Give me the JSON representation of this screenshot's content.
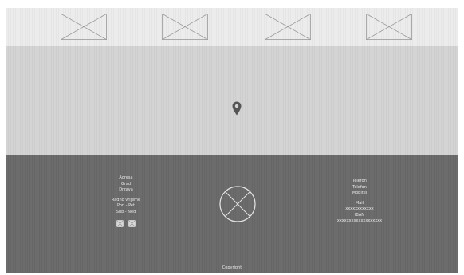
{
  "header": {
    "placeholders": [
      {
        "name": "image-placeholder-1"
      },
      {
        "name": "image-placeholder-2"
      },
      {
        "name": "image-placeholder-3"
      },
      {
        "name": "image-placeholder-4"
      }
    ]
  },
  "map": {
    "icon": "map-pin-icon",
    "pin_color": "#555555"
  },
  "footer": {
    "left_column": {
      "address_lines": [
        "Adresa",
        "Grad",
        "Drzava"
      ],
      "hours_title": "Radno vrijeme",
      "hours": [
        "Pon - Pet",
        "Sub - Ned"
      ],
      "social_icons": [
        "social-placeholder-icon",
        "social-placeholder-icon"
      ]
    },
    "logo_icon": "logo-placeholder-icon",
    "right_column": {
      "lines": [
        "Telefon",
        "Telefon",
        "Mobitel"
      ],
      "contact": [
        "Mail",
        "xxxxxxxxxxxx",
        "IBAN",
        "xxxxxxxxxxxxxxxxxxx"
      ]
    },
    "copyright": "Copyright"
  },
  "colors": {
    "strip": "#ececec",
    "map": "#d4d4d4",
    "footer": "#6c6c6c",
    "footer_text": "#e8e8e8"
  }
}
